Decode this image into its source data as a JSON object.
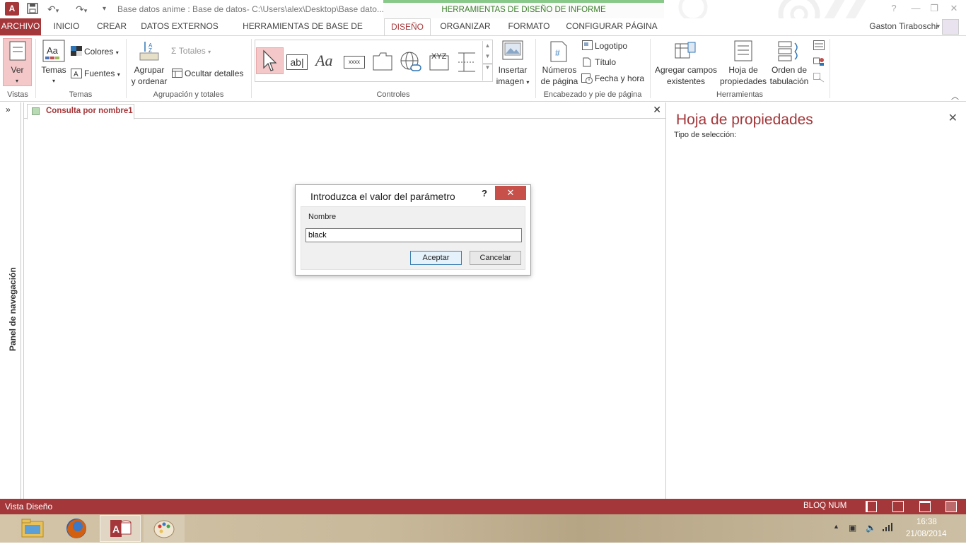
{
  "window": {
    "title": "Base datos anime : Base de datos- C:\\Users\\alex\\Desktop\\Base dato...",
    "context_tab_group": "HERRAMIENTAS DE DISEÑO DE INFORME",
    "help": "?"
  },
  "tabs": [
    "ARCHIVO",
    "INICIO",
    "CREAR",
    "DATOS EXTERNOS",
    "HERRAMIENTAS DE BASE DE DATOS",
    "DISEÑO",
    "ORGANIZAR",
    "FORMATO",
    "CONFIGURAR PÁGINA"
  ],
  "active_tab": "DISEÑO",
  "user": "Gaston Tiraboschi",
  "ribbon": {
    "vistas": {
      "ver": "Ver",
      "label": "Vistas"
    },
    "temas": {
      "temas": "Temas",
      "colores": "Colores",
      "fuentes": "Fuentes",
      "label": "Temas"
    },
    "agrupacion": {
      "agrupar_1": "Agrupar",
      "agrupar_2": "y ordenar",
      "totales": "Totales",
      "ocultar": "Ocultar detalles",
      "label": "Agrupación y totales"
    },
    "controles": {
      "label": "Controles",
      "xyz": "XYZ",
      "xxxx": "xxxx",
      "ab": "ab|",
      "aa": "Aa"
    },
    "insertar": {
      "l1": "Insertar",
      "l2": "imagen"
    },
    "encabezado": {
      "num1": "Números",
      "num2": "de página",
      "logotipo": "Logotipo",
      "titulo": "Título",
      "fecha": "Fecha y hora",
      "label": "Encabezado y pie de página"
    },
    "herramientas": {
      "agregar1": "Agregar campos",
      "agregar2": "existentes",
      "hoja1": "Hoja de",
      "hoja2": "propiedades",
      "orden1": "Orden de",
      "orden2": "tabulación",
      "label": "Herramientas"
    }
  },
  "nav": {
    "label": "Panel de navegación",
    "toggle": "»"
  },
  "document": {
    "tab": "Consulta por nombre1",
    "close": "✕"
  },
  "properties": {
    "title": "Hoja de propiedades",
    "selection": "Tipo de selección:",
    "close": "✕"
  },
  "dialog": {
    "title": "Introduzca el valor del parámetro",
    "help": "?",
    "close": "✕",
    "field_label": "Nombre",
    "value": "black",
    "ok": "Aceptar",
    "cancel": "Cancelar"
  },
  "status": {
    "left": "Vista Diseño",
    "num": "BLOQ NUM"
  },
  "taskbar": {
    "time": "16:38",
    "date": "21/08/2014"
  }
}
